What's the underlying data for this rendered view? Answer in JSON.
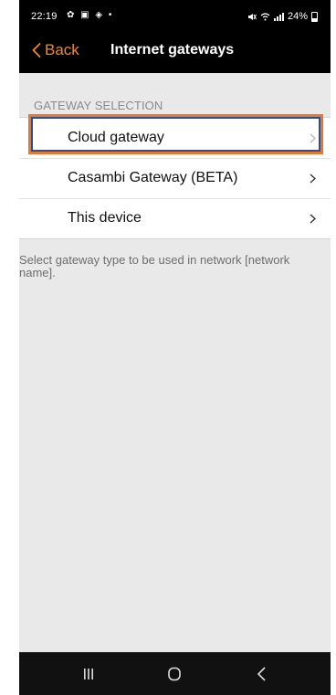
{
  "status_bar": {
    "time": "22:19",
    "left_icons": "✿ ▣ ◈ •",
    "battery_percent": "24%"
  },
  "nav": {
    "back_label": "Back",
    "title": "Internet gateways"
  },
  "section": {
    "header": "GATEWAY SELECTION",
    "items": [
      {
        "label": "Cloud gateway",
        "icon": "chevron-right-icon"
      },
      {
        "label": "Casambi Gateway (BETA)",
        "icon": "chevron-right-icon"
      },
      {
        "label": "This device",
        "icon": "chevron-right-icon"
      }
    ],
    "footer": "Select gateway type to be used in network [network name]."
  },
  "android_nav": {
    "recents_icon": "recents-icon",
    "home_icon": "home-icon",
    "back_icon": "back-icon"
  },
  "colors": {
    "accent": "#f08a2c",
    "highlight_outer": "#e8772d",
    "highlight_inner": "#2c4f8e",
    "background": "#e9e9e9"
  }
}
